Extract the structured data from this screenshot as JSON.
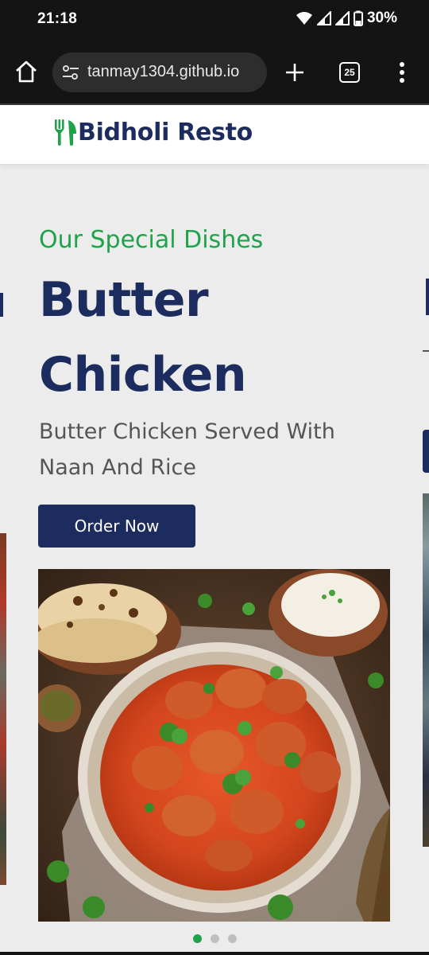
{
  "status_bar": {
    "time": "21:18",
    "battery": "30%"
  },
  "browser": {
    "url": "tanmay1304.github.io",
    "tab_count": "25"
  },
  "site": {
    "brand": "Bidholi Resto",
    "brand_color": "#1d2c5e",
    "accent_color": "#1fa34a"
  },
  "slide": {
    "subtitle": "Our Special Dishes",
    "title": "Butter Chicken",
    "description": "Butter Chicken Served With Naan And Rice",
    "button_label": "Order Now"
  },
  "carousel": {
    "total_slides": 3,
    "active_index": 0
  },
  "icons": {
    "home": "home-icon",
    "site_settings": "tune-icon",
    "new_tab": "plus-icon",
    "tabs": "tab-switcher-icon",
    "menu": "kebab-menu-icon",
    "logo": "fork-knife-icon"
  }
}
